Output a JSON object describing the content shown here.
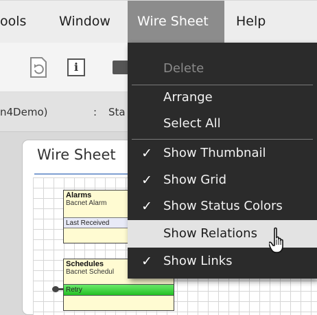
{
  "menubar": {
    "items": [
      {
        "label": "ools"
      },
      {
        "label": "Window"
      },
      {
        "label": "Wire Sheet"
      },
      {
        "label": "Help"
      }
    ]
  },
  "toolbar": {
    "info_glyph": "i",
    "icons": [
      "refresh-icon",
      "info-icon",
      "folder-icon"
    ]
  },
  "breadcrumb": {
    "first": "n4Demo)",
    "separator": ":",
    "second": "Sta"
  },
  "panel": {
    "title": "Wire Sheet"
  },
  "nodes": {
    "alarms": {
      "title": "Alarms",
      "subtitle": "Bacnet Alarm",
      "slot": "Last Received"
    },
    "schedules": {
      "title": "Schedules",
      "subtitle": "Bacnet Schedul",
      "slot": "Retry"
    }
  },
  "menu": {
    "check_glyph": "✓",
    "items": [
      {
        "label": "Delete",
        "enabled": false,
        "checked": false
      },
      {
        "label": "Arrange",
        "enabled": true,
        "checked": false
      },
      {
        "label": "Select All",
        "enabled": true,
        "checked": false
      },
      {
        "label": "Show Thumbnail",
        "enabled": true,
        "checked": true
      },
      {
        "label": "Show Grid",
        "enabled": true,
        "checked": true
      },
      {
        "label": "Show Status Colors",
        "enabled": true,
        "checked": true
      },
      {
        "label": "Show Relations",
        "enabled": true,
        "checked": false,
        "highlighted": true
      },
      {
        "label": "Show Links",
        "enabled": true,
        "checked": true
      }
    ]
  },
  "colors": {
    "menu_background": "#2b2b2b",
    "highlight": "#e3e3e3",
    "active_menubar": "#8c8c8c",
    "status_ok_slot": "#24c024",
    "node_fill": "#fffbd2",
    "title_rule": "#7e9fd1"
  }
}
